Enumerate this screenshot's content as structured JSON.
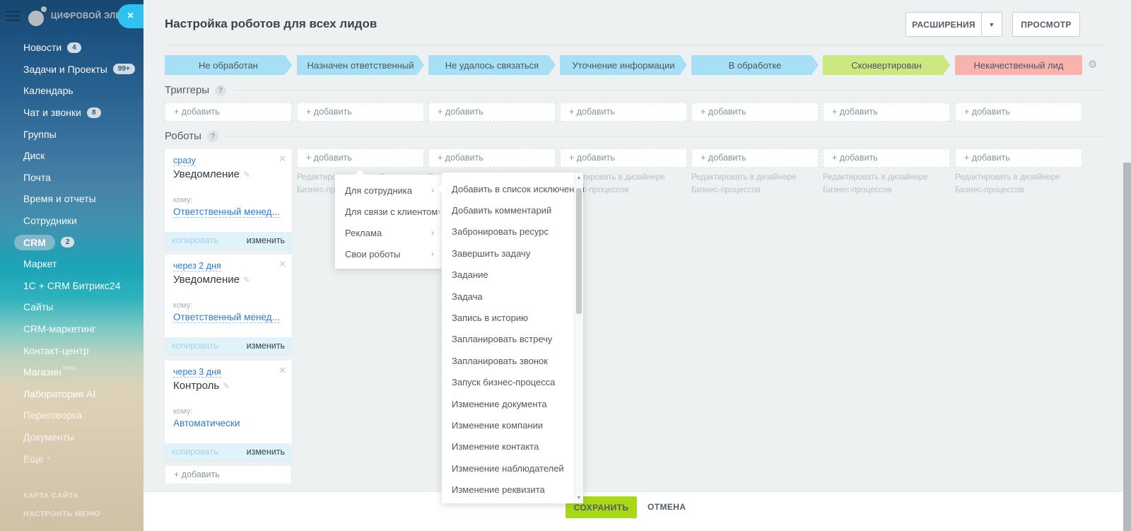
{
  "sidebar": {
    "logo": "ЦИФРОВОЙ ЭЛЕМЕНТ",
    "close_label": "×",
    "items": [
      {
        "label": "Новости",
        "badge": "4"
      },
      {
        "label": "Задачи и Проекты",
        "badge": "99+"
      },
      {
        "label": "Календарь"
      },
      {
        "label": "Чат и звонки",
        "badge": "8"
      },
      {
        "label": "Группы"
      },
      {
        "label": "Диск"
      },
      {
        "label": "Почта"
      },
      {
        "label": "Время и отчеты"
      },
      {
        "label": "Сотрудники"
      },
      {
        "label": "CRM",
        "badge": "2",
        "active": true
      },
      {
        "label": "Маркет"
      },
      {
        "label": "1С + CRM Битрикс24"
      },
      {
        "label": "Сайты"
      },
      {
        "label": "CRM-маркетинг"
      },
      {
        "label": "Контакт-центр"
      },
      {
        "label": "Магазин",
        "suffix": "beta"
      },
      {
        "label": "Лаборатория AI"
      },
      {
        "label": "Переговорка"
      },
      {
        "label": "Документы"
      },
      {
        "label": "Ещё"
      }
    ],
    "footer_links": [
      {
        "label": "КАРТА САЙТА"
      },
      {
        "label": "НАСТРОИТЬ МЕНЮ"
      }
    ]
  },
  "header": {
    "title": "Настройка роботов для всех лидов",
    "extensions_button": "РАСШИРЕНИЯ",
    "view_button": "ПРОСМОТР"
  },
  "statuses": [
    {
      "label": "Не обработан",
      "color": "#a7e0f6"
    },
    {
      "label": "Назначен ответственный",
      "color": "#a7e0f6"
    },
    {
      "label": "Не удалось связаться",
      "color": "#a7e0f6"
    },
    {
      "label": "Уточнение информации",
      "color": "#a7e0f6"
    },
    {
      "label": "В обработке",
      "color": "#a7e0f6"
    },
    {
      "label": "Сконвертирован",
      "color": "#cde881"
    },
    {
      "label": "Некачественный лид",
      "color": "#f9b3ae"
    }
  ],
  "triggers": {
    "heading": "Триггеры",
    "add_label": "+ добавить"
  },
  "robots": {
    "heading": "Роботы",
    "add_label": "+ добавить",
    "designer_hint": "Редактировать в дизайнере Бизнес-процессов",
    "cards": [
      {
        "when": "сразу",
        "title": "Уведомление",
        "to_label": "кому:",
        "to": "Ответственный менед...",
        "copy_label": "копировать",
        "edit_label": "изменить"
      },
      {
        "when": "через 2 дня",
        "title": "Уведомление",
        "to_label": "кому:",
        "to": "Ответственный менед...",
        "copy_label": "копировать",
        "edit_label": "изменить"
      },
      {
        "when": "через 3 дня",
        "title": "Контроль",
        "to_label": "кому:",
        "to": "Автоматически",
        "copy_label": "копировать",
        "edit_label": "изменить"
      }
    ]
  },
  "menu": {
    "categories": [
      {
        "label": "Для сотрудника"
      },
      {
        "label": "Для связи с клиентом"
      },
      {
        "label": "Реклама"
      },
      {
        "label": "Свои роботы"
      }
    ],
    "actions": [
      {
        "label": "Добавить в список исключений"
      },
      {
        "label": "Добавить комментарий"
      },
      {
        "label": "Забронировать ресурс"
      },
      {
        "label": "Завершить задачу"
      },
      {
        "label": "Задание"
      },
      {
        "label": "Задача"
      },
      {
        "label": "Запись в историю"
      },
      {
        "label": "Запланировать встречу"
      },
      {
        "label": "Запланировать звонок"
      },
      {
        "label": "Запуск бизнес-процесса"
      },
      {
        "label": "Изменение документа"
      },
      {
        "label": "Изменение компании"
      },
      {
        "label": "Изменение контакта"
      },
      {
        "label": "Изменение наблюдателей"
      },
      {
        "label": "Изменение реквизита"
      }
    ]
  },
  "footer": {
    "save_label": "СОХРАНИТЬ",
    "cancel_label": "ОТМЕНА"
  }
}
